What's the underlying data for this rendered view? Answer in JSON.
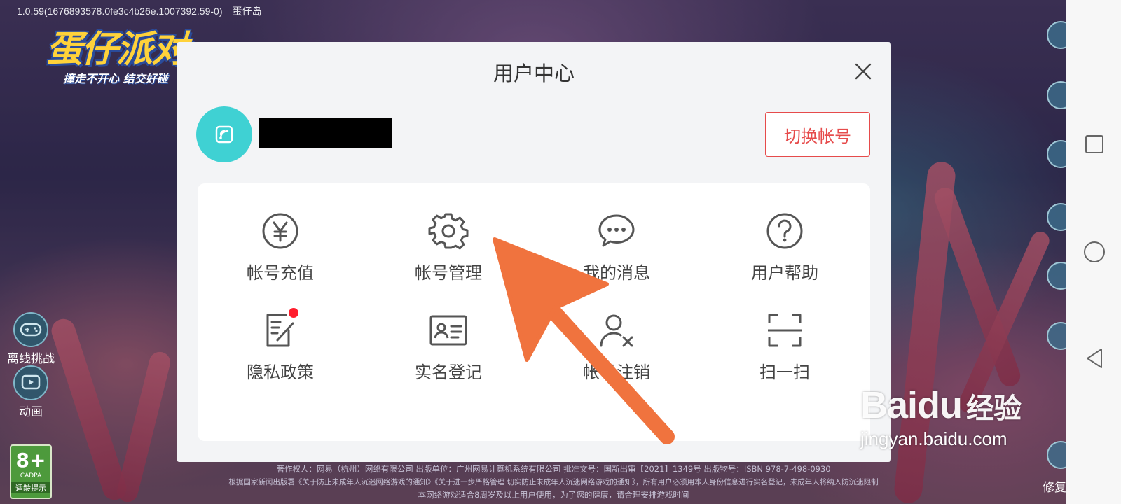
{
  "game": {
    "version": "1.0.59(1676893578.0fe3c4b26e.1007392.59-0)　蛋仔岛",
    "logo_main": "蛋仔派对",
    "logo_sub": "撞走不开心 结交好碰",
    "side_buttons": [
      {
        "label": "离线挑战",
        "icon": "gamepad-icon"
      },
      {
        "label": "动画",
        "icon": "play-icon"
      }
    ],
    "age_badge": {
      "rating": "8+",
      "org": "CADPA",
      "label": "适龄提示"
    },
    "right_label": "修复",
    "footer_lines": [
      "著作权人：网易（杭州）网络有限公司 出版单位：广州网易计算机系统有限公司 批准文号：国新出审【2021】1349号 出版物号：ISBN 978-7-498-0930",
      "根据国家新闻出版署《关于防止未成年人沉迷网络游戏的通知》《关于进一步严格管理 切实防止未成年人沉迷网络游戏的通知》，所有用户必须用本人身份信息进行实名登记，未成年人将纳入防沉迷限制",
      "本网络游戏适合8周岁及以上用户使用，为了您的健康，请合理安排游戏时间"
    ]
  },
  "dialog": {
    "title": "用户中心",
    "close_icon": "close-icon",
    "username": "",
    "switch_account": "切换帐号",
    "avatar_color": "#3fd1d3",
    "accent_color": "#e64b4b",
    "items": [
      {
        "label": "帐号充值",
        "icon": "yen-icon"
      },
      {
        "label": "帐号管理",
        "icon": "gear-icon"
      },
      {
        "label": "我的消息",
        "icon": "message-icon"
      },
      {
        "label": "用户帮助",
        "icon": "help-icon"
      },
      {
        "label": "隐私政策",
        "icon": "policy-icon"
      },
      {
        "label": "实名登记",
        "icon": "id-card-icon"
      },
      {
        "label": "帐号注销",
        "icon": "user-remove-icon"
      },
      {
        "label": "扫一扫",
        "icon": "scan-icon"
      }
    ]
  },
  "watermark": {
    "logo": "Baidu",
    "brand": "经验",
    "url": "jingyan.baidu.com"
  },
  "android_nav": [
    "square-icon",
    "circle-icon",
    "triangle-back-icon"
  ]
}
